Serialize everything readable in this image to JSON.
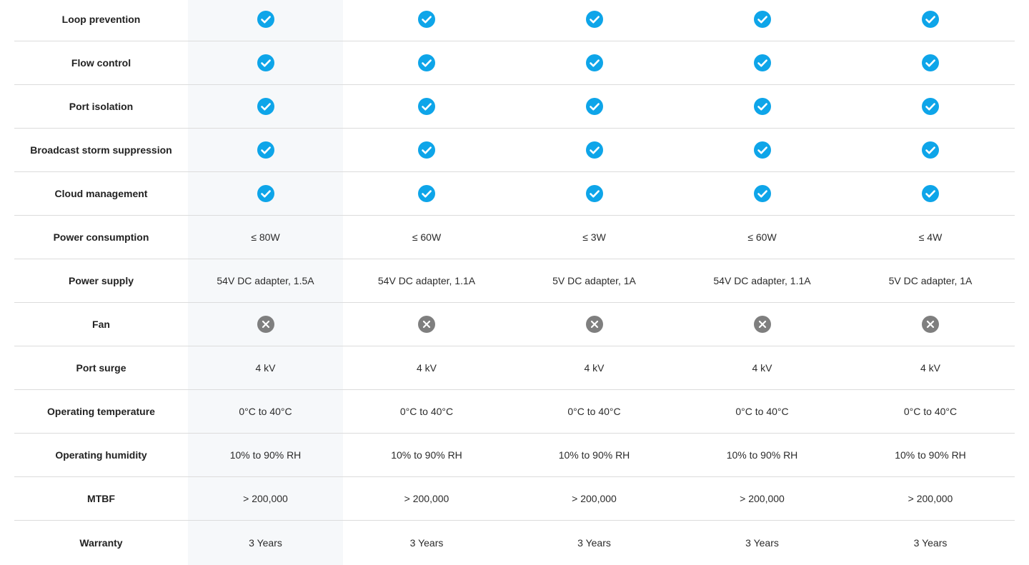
{
  "colors": {
    "check": "#0ea5e9",
    "cross": "#7f7f7f",
    "highlight": "#f6f8fa",
    "divider": "#dcdcdc"
  },
  "icons": {
    "check": "check-circle-icon",
    "cross": "x-circle-icon"
  },
  "rows": [
    {
      "label": "Loop prevention",
      "values": [
        "check",
        "check",
        "check",
        "check",
        "check"
      ]
    },
    {
      "label": "Flow control",
      "values": [
        "check",
        "check",
        "check",
        "check",
        "check"
      ]
    },
    {
      "label": "Port isolation",
      "values": [
        "check",
        "check",
        "check",
        "check",
        "check"
      ]
    },
    {
      "label": "Broadcast storm suppression",
      "values": [
        "check",
        "check",
        "check",
        "check",
        "check"
      ]
    },
    {
      "label": "Cloud management",
      "values": [
        "check",
        "check",
        "check",
        "check",
        "check"
      ]
    },
    {
      "label": "Power consumption",
      "values": [
        "≤ 80W",
        "≤ 60W",
        "≤ 3W",
        "≤ 60W",
        "≤ 4W"
      ]
    },
    {
      "label": "Power supply",
      "values": [
        "54V DC adapter, 1.5A",
        "54V DC adapter, 1.1A",
        "5V DC adapter, 1A",
        "54V DC adapter, 1.1A",
        "5V DC adapter, 1A"
      ]
    },
    {
      "label": "Fan",
      "values": [
        "cross",
        "cross",
        "cross",
        "cross",
        "cross"
      ]
    },
    {
      "label": "Port surge",
      "values": [
        "4 kV",
        "4 kV",
        "4 kV",
        "4 kV",
        "4 kV"
      ]
    },
    {
      "label": "Operating temperature",
      "values": [
        "0°C to 40°C",
        "0°C to 40°C",
        "0°C to 40°C",
        "0°C to 40°C",
        "0°C to 40°C"
      ]
    },
    {
      "label": "Operating humidity",
      "values": [
        "10% to 90% RH",
        "10% to 90% RH",
        "10% to 90% RH",
        "10% to 90% RH",
        "10% to 90% RH"
      ]
    },
    {
      "label": "MTBF",
      "values": [
        "> 200,000",
        "> 200,000",
        "> 200,000",
        "> 200,000",
        "> 200,000"
      ]
    },
    {
      "label": "Warranty",
      "values": [
        "3 Years",
        "3 Years",
        "3 Years",
        "3 Years",
        "3 Years"
      ]
    }
  ]
}
